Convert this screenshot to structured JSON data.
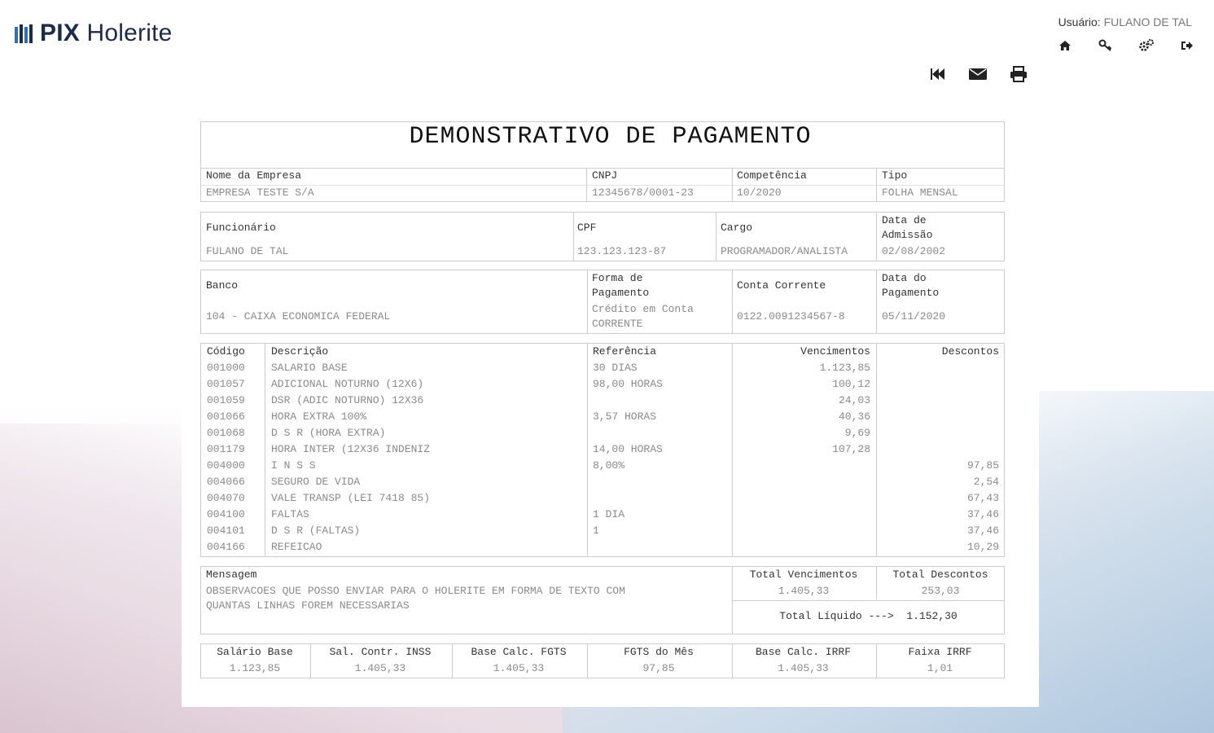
{
  "app": {
    "logo_bold": "PIX",
    "logo_light": "Holerite"
  },
  "user": {
    "label": "Usuário:",
    "name": "FULANO DE TAL"
  },
  "top_icons": [
    "home-icon",
    "key-icon",
    "settings-icon",
    "logout-icon"
  ],
  "action_icons": [
    "back-icon",
    "mail-icon",
    "print-icon"
  ],
  "doc": {
    "title": "DEMONSTRATIVO DE PAGAMENTO",
    "empresa_label": "Nome da Empresa",
    "empresa": "EMPRESA TESTE S/A",
    "cnpj_label": "CNPJ",
    "cnpj": "12345678/0001-23",
    "competencia_label": "Competência",
    "competencia": "10/2020",
    "tipo_label": "Tipo",
    "tipo": "FOLHA MENSAL",
    "funcionario_label": "Funcionário",
    "funcionario": "FULANO DE TAL",
    "cpf_label": "CPF",
    "cpf": "123.123.123-87",
    "cargo_label": "Cargo",
    "cargo": "PROGRAMADOR/ANALISTA",
    "admissao_label_1": "Data de",
    "admissao_label_2": "Admissão",
    "admissao": "02/08/2002",
    "banco_label": "Banco",
    "banco": "104 - CAIXA ECONOMICA FEDERAL",
    "forma_label_1": "Forma de",
    "forma_label_2": "Pagamento",
    "forma_1": "Crédito em Conta",
    "forma_2": "CORRENTE",
    "conta_label": "Conta Corrente",
    "conta": "0122.0091234567-8",
    "datapag_label_1": "Data do",
    "datapag_label_2": "Pagamento",
    "datapag": "05/11/2020"
  },
  "table": {
    "headers": {
      "codigo": "Código",
      "descricao": "Descrição",
      "referencia": "Referência",
      "vencimentos": "Vencimentos",
      "descontos": "Descontos"
    },
    "rows": [
      {
        "codigo": "001000",
        "descricao": "SALARIO BASE",
        "referencia": "30 DIAS",
        "vencimentos": "1.123,85",
        "descontos": ""
      },
      {
        "codigo": "001057",
        "descricao": "ADICIONAL NOTURNO (12X6)",
        "referencia": "98,00 HORAS",
        "vencimentos": "100,12",
        "descontos": ""
      },
      {
        "codigo": "001059",
        "descricao": "DSR (ADIC NOTURNO) 12X36",
        "referencia": "",
        "vencimentos": "24,03",
        "descontos": ""
      },
      {
        "codigo": "001066",
        "descricao": "HORA EXTRA 100%",
        "referencia": "3,57 HORAS",
        "vencimentos": "40,36",
        "descontos": ""
      },
      {
        "codigo": "001068",
        "descricao": "D S R (HORA EXTRA)",
        "referencia": "",
        "vencimentos": "9,69",
        "descontos": ""
      },
      {
        "codigo": "001179",
        "descricao": "HORA INTER (12X36 INDENIZ",
        "referencia": "14,00 HORAS",
        "vencimentos": "107,28",
        "descontos": ""
      },
      {
        "codigo": "004000",
        "descricao": "I N S S",
        "referencia": "8,00%",
        "vencimentos": "",
        "descontos": "97,85"
      },
      {
        "codigo": "004066",
        "descricao": "SEGURO DE VIDA",
        "referencia": "",
        "vencimentos": "",
        "descontos": "2,54"
      },
      {
        "codigo": "004070",
        "descricao": "VALE TRANSP (LEI 7418 85)",
        "referencia": "",
        "vencimentos": "",
        "descontos": "67,43"
      },
      {
        "codigo": "004100",
        "descricao": "FALTAS",
        "referencia": "1 DIA",
        "vencimentos": "",
        "descontos": "37,46"
      },
      {
        "codigo": "004101",
        "descricao": "D S R (FALTAS)",
        "referencia": "1",
        "vencimentos": "",
        "descontos": "37,46"
      },
      {
        "codigo": "004166",
        "descricao": "REFEICAO",
        "referencia": "",
        "vencimentos": "",
        "descontos": "10,29"
      }
    ]
  },
  "message": {
    "label": "Mensagem",
    "line1": "OBSERVACOES QUE POSSO ENVIAR PARA O HOLERITE EM FORMA DE TEXTO COM",
    "line2": "QUANTAS LINHAS FOREM NECESSARIAS"
  },
  "totals": {
    "venc_label": "Total Vencimentos",
    "venc": "1.405,33",
    "desc_label": "Total Descontos",
    "desc": "253,03",
    "liquido_label": "Total Líquido --->",
    "liquido": "1.152,30"
  },
  "bases": [
    {
      "label": "Salário Base",
      "value": "1.123,85"
    },
    {
      "label": "Sal. Contr. INSS",
      "value": "1.405,33"
    },
    {
      "label": "Base Calc. FGTS",
      "value": "1.405,33"
    },
    {
      "label": "FGTS do Mês",
      "value": "97,85"
    },
    {
      "label": "Base Calc. IRRF",
      "value": "1.405,33"
    },
    {
      "label": "Faixa IRRF",
      "value": "1,01"
    }
  ],
  "colors": {
    "brand": "#1c2b4a",
    "logo_blue": "#2f6fb7",
    "border": "#cccccc",
    "value_text": "#8a8a8a"
  }
}
